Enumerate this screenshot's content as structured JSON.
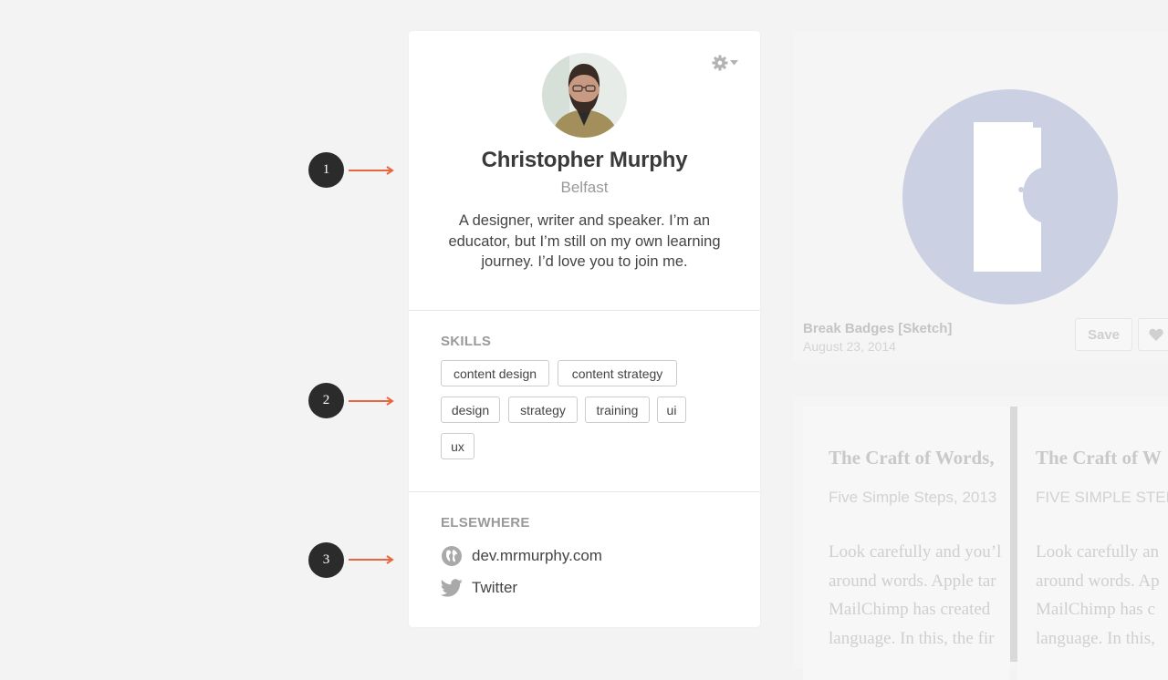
{
  "profile": {
    "name": "Christopher Murphy",
    "location": "Belfast",
    "bio": "A designer, writer and speaker. I’m an educator, but I’m still on my own learning journey. I’d love you to join me.",
    "settings_icon": "gear-icon"
  },
  "skills": {
    "title": "SKILLS",
    "tags": [
      "content design",
      "content strategy",
      "design",
      "strategy",
      "training",
      "ui",
      "ux"
    ]
  },
  "elsewhere": {
    "title": "ELSEWHERE",
    "links": [
      {
        "label": "dev.mrmurphy.com",
        "icon": "globe-icon"
      },
      {
        "label": "Twitter",
        "icon": "twitter-icon"
      }
    ]
  },
  "markers": [
    "1",
    "2",
    "3"
  ],
  "background": {
    "item_title": "Break Badges [Sketch]",
    "item_date": "August 23, 2014",
    "save_label": "Save",
    "book_title": "The Craft of Words,",
    "book_title_2": "The Craft of W",
    "book_subtitle": "Five Simple Steps, 2013",
    "book_subtitle_2": "FIVE SIMPLE STEPS,",
    "book_lines": [
      "Look carefully and you’l",
      "around words. Apple tar",
      "MailChimp has created",
      "language. In this, the fir"
    ],
    "book_lines_2": [
      "Look carefully an",
      "around words. Ap",
      "MailChimp has c",
      "language. In this,"
    ]
  },
  "colors": {
    "accent_arrow": "#e8663d",
    "marker_bg": "#2b2b2b",
    "badge_bg": "#cbd0e2"
  }
}
